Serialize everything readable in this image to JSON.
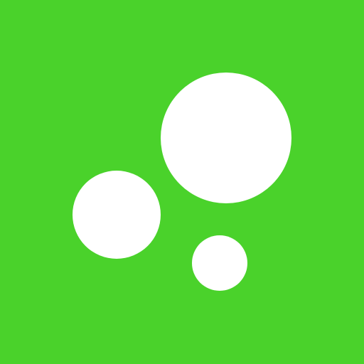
{
  "icon": {
    "semantic": "bubbles-icon",
    "background_color": "#4AD22B",
    "foreground_color": "#FFFFFF"
  }
}
